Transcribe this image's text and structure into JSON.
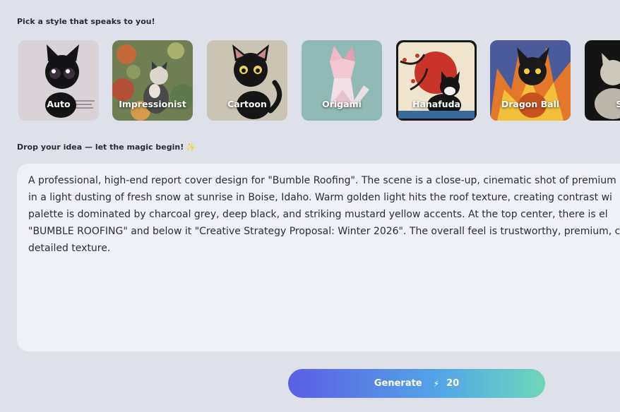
{
  "style_section": {
    "label": "Pick a style that speaks to you!",
    "styles": [
      {
        "label": "Auto",
        "bg": "#d8d2d6"
      },
      {
        "label": "Impressionist",
        "bg": "#7a8a5a"
      },
      {
        "label": "Cartoon",
        "bg": "#c9c2b2"
      },
      {
        "label": "Origami",
        "bg": "#8fbab5"
      },
      {
        "label": "Hanafuda",
        "bg": "#efe6d2"
      },
      {
        "label": "Dragon Ball",
        "bg": "#c5502a"
      },
      {
        "label": "Scu",
        "bg": "#2b2b2b"
      }
    ]
  },
  "idea_section": {
    "label": "Drop your idea — let the magic begin!",
    "sparkle": "✨",
    "prompt_text": "A professional, high-end report cover design for \"Bumble Roofing\". The scene is a close-up, cinematic shot of premium\nin a light dusting of fresh snow at sunrise in Boise, Idaho. Warm golden light hits the roof texture, creating contrast wi\npalette is dominated by charcoal grey, deep black, and striking mustard yellow accents. At the top center, there is el\n\"BUMBLE ROOFING\" and below it \"Creative Strategy Proposal: Winter 2026\". The overall feel is trustworthy, premium, c\ndetailed texture."
  },
  "generate": {
    "label": "Generate",
    "icon": "lightning-bolt-icon",
    "cost": "20"
  }
}
